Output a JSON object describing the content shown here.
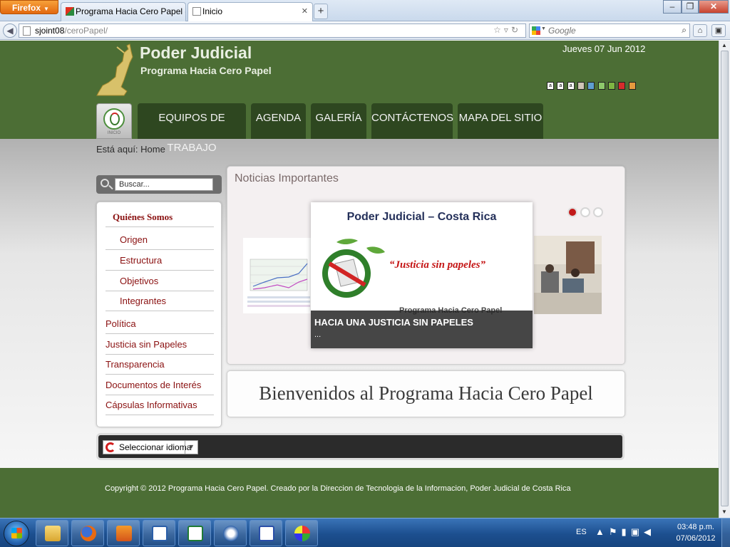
{
  "browser": {
    "app_button": "Firefox",
    "tabs": [
      {
        "label": "Programa Hacia Cero Papel -..."
      },
      {
        "label": "Inicio"
      }
    ],
    "url_host": "sjoint08",
    "url_path": "/ceroPapel/",
    "search_placeholder": "Google"
  },
  "header": {
    "title": "Poder Judicial",
    "subtitle": "Programa Hacia Cero Papel",
    "date": "Jueves 07 Jun 2012",
    "access_font_labels": [
      "a",
      "a",
      "a"
    ],
    "theme_colors": [
      "#cfc5b6",
      "#5f9fd2",
      "#8ec96b",
      "#7fb642",
      "#d72c2c",
      "#e59a3e"
    ]
  },
  "nav": {
    "home_label": "INICIO",
    "items": [
      "EQUIPOS DE TRABAJO",
      "AGENDA",
      "GALERÍA",
      "CONTÁCTENOS",
      "MAPA DEL SITIO"
    ]
  },
  "breadcrumb": "Está aquí:  Home",
  "search": {
    "placeholder": "Buscar..."
  },
  "sidebar": {
    "items": [
      {
        "label": "Quiénes Somos"
      },
      {
        "label": "Origen"
      },
      {
        "label": "Estructura"
      },
      {
        "label": "Objetivos"
      },
      {
        "label": "Integrantes"
      },
      {
        "label": "Política"
      },
      {
        "label": "Justicia sin Papeles"
      },
      {
        "label": "Transparencia"
      },
      {
        "label": "Documentos de Interés"
      },
      {
        "label": "Cápsulas Informativas"
      }
    ]
  },
  "news": {
    "title": "Noticias Importantes",
    "slide_heading": "Poder Judicial – Costa Rica",
    "slide_tagline": "“Justicia sin papeles”",
    "slide_ghost": "Programa Hacia Cero Papel",
    "caption_title": "HACIA UNA JUSTICIA SIN PAPELES",
    "caption_more": "...",
    "active_slide": 1,
    "slide_count": 3
  },
  "welcome": "Bienvenidos al Programa Hacia Cero Papel",
  "language": {
    "label": "Seleccionar idioma"
  },
  "footer": "Copyright © 2012 Programa Hacia Cero Papel. Creado por la Direccion de Tecnologia de la Informacion, Poder Judicial de Costa Rica",
  "taskbar": {
    "lang": "ES",
    "time": "03:48 p.m.",
    "date": "07/06/2012",
    "apps": [
      "explorer-icon",
      "firefox-icon",
      "media-player-icon",
      "publisher-icon",
      "excel-icon",
      "outlook-icon",
      "word-icon",
      "paint-icon"
    ]
  }
}
